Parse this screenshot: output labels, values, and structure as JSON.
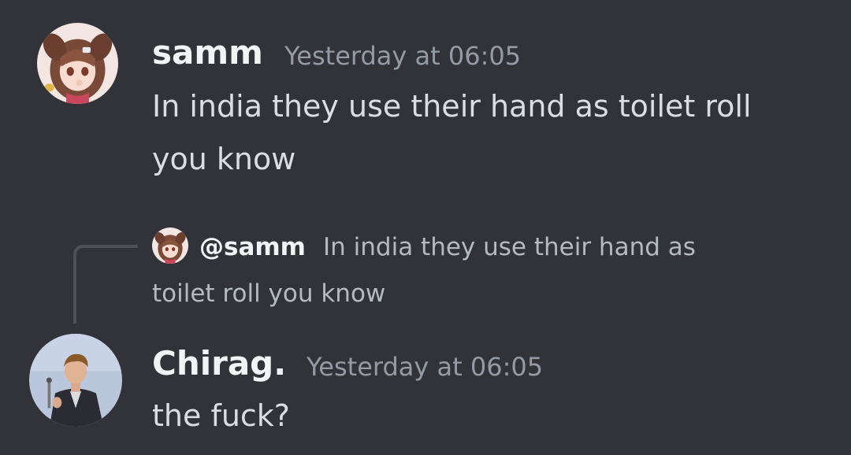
{
  "messages": [
    {
      "username": "samm",
      "timestamp": "Yesterday at 06:05",
      "lines": [
        "In india they use their hand as toilet roll",
        "you know"
      ],
      "avatar_icon": "anime-girl-avatar"
    },
    {
      "reply": {
        "mention": "@samm",
        "text_line1": "In india they use their hand as",
        "text_line2": "toilet roll you know",
        "avatar_icon": "anime-girl-avatar"
      },
      "username": "Chirag.",
      "timestamp": "Yesterday at 06:05",
      "lines": [
        "the fuck?"
      ],
      "avatar_icon": "man-in-trenchcoat-avatar"
    }
  ],
  "colors": {
    "background": "#313338",
    "username": "#f2f3f5",
    "timestamp": "#949ba4",
    "message_text": "#dbdee1",
    "reply_text": "#b5bac1",
    "reply_spine": "#4e5058"
  }
}
